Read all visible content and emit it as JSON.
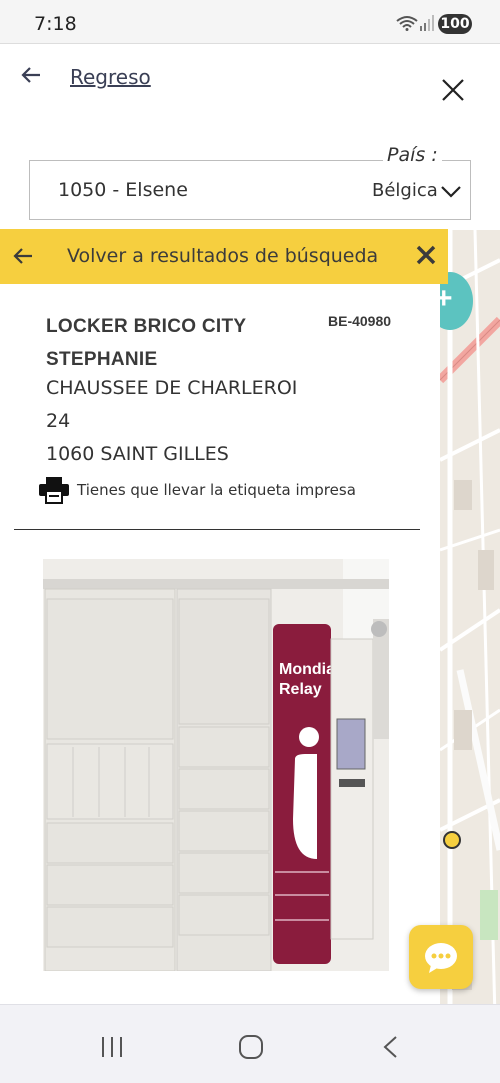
{
  "status_bar": {
    "time": "7:18",
    "battery": "100"
  },
  "header": {
    "back_label": "Regreso"
  },
  "search": {
    "location_value": "1050 - Elsene",
    "country_label": "País :",
    "country_value": "Bélgica"
  },
  "results_bar": {
    "label": "Volver a resultados de búsqueda"
  },
  "relay_point": {
    "name": "LOCKER BRICO CITY STEPHANIE",
    "code": "BE-40980",
    "street": "CHAUSSEE DE CHARLEROI",
    "number": "24",
    "city": "1060 SAINT GILLES",
    "print_note": "Tienes que llevar la etiqueta impresa"
  },
  "photo": {
    "brand_line1": "Mondial",
    "brand_line2": "Relay"
  },
  "colors": {
    "accent_yellow": "#f6cf3f",
    "map_teal": "#5cc3c0",
    "locker_red": "#8a1c3d"
  },
  "icons": [
    "back-arrow-icon",
    "close-icon",
    "chevron-down-icon",
    "printer-icon",
    "chat-icon",
    "wifi-icon",
    "signal-icon"
  ]
}
